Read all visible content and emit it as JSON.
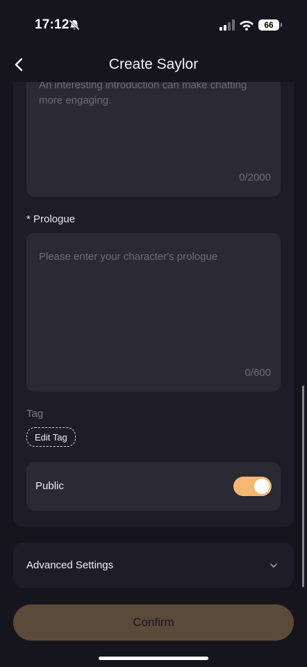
{
  "status_bar": {
    "time": "17:12",
    "battery": "66",
    "icons": [
      "bell-slash-icon",
      "signal-icon",
      "wifi-icon",
      "battery-icon"
    ]
  },
  "nav": {
    "title": "Create Saylor",
    "back_icon": "chevron-left-icon"
  },
  "form": {
    "introduction": {
      "placeholder": "An interesting introduction can make chatting more engaging.",
      "counter": "0/2000"
    },
    "prologue": {
      "label": "* Prologue",
      "placeholder": "Please enter your character's prologue",
      "counter": "0/600"
    },
    "tag": {
      "label": "Tag",
      "edit_button": "Edit Tag"
    },
    "public": {
      "label": "Public",
      "enabled": true
    }
  },
  "advanced": {
    "label": "Advanced Settings",
    "icon": "chevron-down-icon"
  },
  "confirm_label": "Confirm",
  "colors": {
    "background": "#16151e",
    "card": "#1e1d27",
    "field": "#2a2934",
    "accent": "#f5b772",
    "confirm_disabled": "#5a4a39"
  }
}
